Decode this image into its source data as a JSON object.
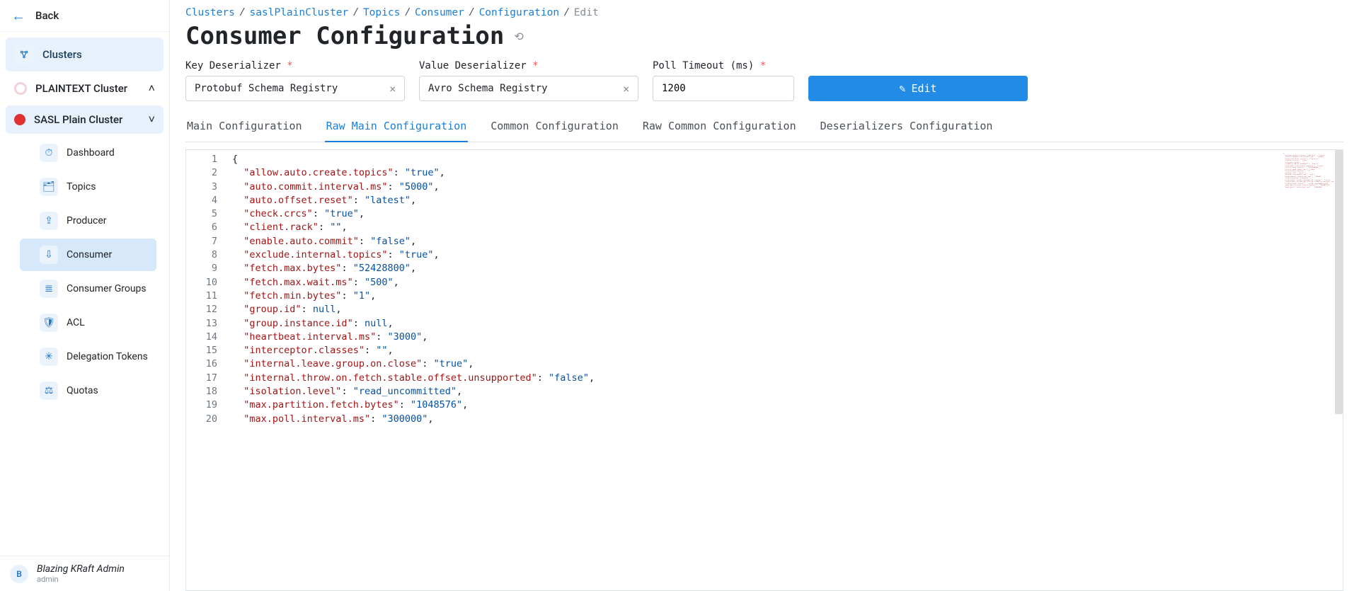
{
  "sidebar": {
    "back_label": "Back",
    "root_label": "Clusters",
    "clusters": [
      {
        "name": "PLAINTEXT Cluster",
        "color": "outline",
        "expanded": false,
        "chev": "˄"
      },
      {
        "name": "SASL Plain Cluster",
        "color": "#e03131",
        "expanded": true,
        "chev": "˅"
      }
    ],
    "items": [
      {
        "label": "Dashboard",
        "icon": "⏱",
        "active": false
      },
      {
        "label": "Topics",
        "icon": "🗂",
        "active": false
      },
      {
        "label": "Producer",
        "icon": "⇪",
        "active": false
      },
      {
        "label": "Consumer",
        "icon": "⇩",
        "active": true
      },
      {
        "label": "Consumer Groups",
        "icon": "≣",
        "active": false
      },
      {
        "label": "ACL",
        "icon": "🛡",
        "active": false
      },
      {
        "label": "Delegation Tokens",
        "icon": "✳",
        "active": false
      },
      {
        "label": "Quotas",
        "icon": "⚖",
        "active": false
      }
    ],
    "footer": {
      "initial": "B",
      "name": "Blazing KRaft Admin",
      "role": "admin"
    }
  },
  "breadcrumb": [
    {
      "label": "Clusters",
      "link": true
    },
    {
      "label": "saslPlainCluster",
      "link": true
    },
    {
      "label": "Topics",
      "link": true
    },
    {
      "label": "Consumer",
      "link": true
    },
    {
      "label": "Configuration",
      "link": true
    },
    {
      "label": "Edit",
      "link": false
    }
  ],
  "page_title": "Consumer Configuration",
  "form": {
    "key_deser_label": "Key Deserializer",
    "key_deser_value": "Protobuf Schema Registry",
    "value_deser_label": "Value Deserializer",
    "value_deser_value": "Avro Schema Registry",
    "poll_label": "Poll Timeout (ms)",
    "poll_value": "1200",
    "edit_btn": "Edit"
  },
  "tabs": [
    {
      "label": "Main Configuration",
      "active": false
    },
    {
      "label": "Raw Main Configuration",
      "active": true
    },
    {
      "label": "Common Configuration",
      "active": false
    },
    {
      "label": "Raw Common Configuration",
      "active": false
    },
    {
      "label": "Deserializers Configuration",
      "active": false
    }
  ],
  "editor": {
    "lines": [
      {
        "raw": "{"
      },
      {
        "key": "allow.auto.create.topics",
        "val": "\"true\"",
        "type": "s",
        "comma": true
      },
      {
        "key": "auto.commit.interval.ms",
        "val": "\"5000\"",
        "type": "s",
        "comma": true
      },
      {
        "key": "auto.offset.reset",
        "val": "\"latest\"",
        "type": "s",
        "comma": true
      },
      {
        "key": "check.crcs",
        "val": "\"true\"",
        "type": "s",
        "comma": true
      },
      {
        "key": "client.rack",
        "val": "\"\"",
        "type": "s",
        "comma": true
      },
      {
        "key": "enable.auto.commit",
        "val": "\"false\"",
        "type": "s",
        "comma": true
      },
      {
        "key": "exclude.internal.topics",
        "val": "\"true\"",
        "type": "s",
        "comma": true
      },
      {
        "key": "fetch.max.bytes",
        "val": "\"52428800\"",
        "type": "s",
        "comma": true
      },
      {
        "key": "fetch.max.wait.ms",
        "val": "\"500\"",
        "type": "s",
        "comma": true
      },
      {
        "key": "fetch.min.bytes",
        "val": "\"1\"",
        "type": "s",
        "comma": true
      },
      {
        "key": "group.id",
        "val": "null",
        "type": "nl",
        "comma": true
      },
      {
        "key": "group.instance.id",
        "val": "null",
        "type": "nl",
        "comma": true
      },
      {
        "key": "heartbeat.interval.ms",
        "val": "\"3000\"",
        "type": "s",
        "comma": true
      },
      {
        "key": "interceptor.classes",
        "val": "\"\"",
        "type": "s",
        "comma": true
      },
      {
        "key": "internal.leave.group.on.close",
        "val": "\"true\"",
        "type": "s",
        "comma": true
      },
      {
        "key": "internal.throw.on.fetch.stable.offset.unsupported",
        "val": "\"false\"",
        "type": "s",
        "comma": true
      },
      {
        "key": "isolation.level",
        "val": "\"read_uncommitted\"",
        "type": "s",
        "comma": true
      },
      {
        "key": "max.partition.fetch.bytes",
        "val": "\"1048576\"",
        "type": "s",
        "comma": true
      },
      {
        "key": "max.poll.interval.ms",
        "val": "\"300000\"",
        "type": "s",
        "comma": true
      }
    ]
  }
}
